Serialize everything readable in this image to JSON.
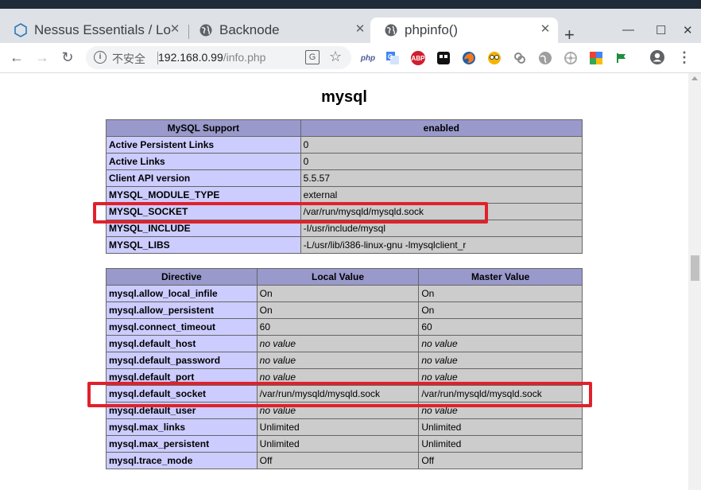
{
  "browser": {
    "tabs": [
      {
        "label": "Nessus Essentials / Lo",
        "icon": "nessus-icon"
      },
      {
        "label": "Backnode",
        "icon": "globe-icon"
      },
      {
        "label": "phpinfo()",
        "icon": "globe-icon",
        "active": true
      }
    ],
    "new_tab_label": "+",
    "window_controls": {
      "minimize": "—",
      "maximize": "☐",
      "close": "✕"
    },
    "nav": {
      "back": "←",
      "forward": "→",
      "reload": "↻"
    },
    "address": {
      "security_label": "不安全",
      "host": "192.168.0.99",
      "path": "/info.php"
    },
    "extensions": [
      "php-icon",
      "translate-ext-icon",
      "adblock-icon",
      "extension-icon",
      "firefox-icon",
      "face-icon",
      "link-icon",
      "globe-ext-icon",
      "wheel-icon",
      "google-icon",
      "flag-icon"
    ],
    "ext_labels": {
      "php": "php",
      "abp": "ABP"
    },
    "menu": "⋮"
  },
  "page": {
    "section_title": "mysql",
    "support_table": {
      "headers": [
        "MySQL Support",
        "enabled"
      ],
      "rows": [
        {
          "key": "Active Persistent Links",
          "value": "0"
        },
        {
          "key": "Active Links",
          "value": "0"
        },
        {
          "key": "Client API version",
          "value": "5.5.57"
        },
        {
          "key": "MYSQL_MODULE_TYPE",
          "value": "external"
        },
        {
          "key": "MYSQL_SOCKET",
          "value": "/var/run/mysqld/mysqld.sock"
        },
        {
          "key": "MYSQL_INCLUDE",
          "value": "-I/usr/include/mysql"
        },
        {
          "key": "MYSQL_LIBS",
          "value": "-L/usr/lib/i386-linux-gnu -lmysqlclient_r"
        }
      ]
    },
    "directive_table": {
      "headers": [
        "Directive",
        "Local Value",
        "Master Value"
      ],
      "rows": [
        {
          "directive": "mysql.allow_local_infile",
          "local": "On",
          "master": "On"
        },
        {
          "directive": "mysql.allow_persistent",
          "local": "On",
          "master": "On"
        },
        {
          "directive": "mysql.connect_timeout",
          "local": "60",
          "master": "60"
        },
        {
          "directive": "mysql.default_host",
          "local": "no value",
          "master": "no value"
        },
        {
          "directive": "mysql.default_password",
          "local": "no value",
          "master": "no value"
        },
        {
          "directive": "mysql.default_port",
          "local": "no value",
          "master": "no value"
        },
        {
          "directive": "mysql.default_socket",
          "local": "/var/run/mysqld/mysqld.sock",
          "master": "/var/run/mysqld/mysqld.sock"
        },
        {
          "directive": "mysql.default_user",
          "local": "no value",
          "master": "no value"
        },
        {
          "directive": "mysql.max_links",
          "local": "Unlimited",
          "master": "Unlimited"
        },
        {
          "directive": "mysql.max_persistent",
          "local": "Unlimited",
          "master": "Unlimited"
        },
        {
          "directive": "mysql.trace_mode",
          "local": "Off",
          "master": "Off"
        }
      ]
    },
    "highlight_color": "#e0212b"
  }
}
